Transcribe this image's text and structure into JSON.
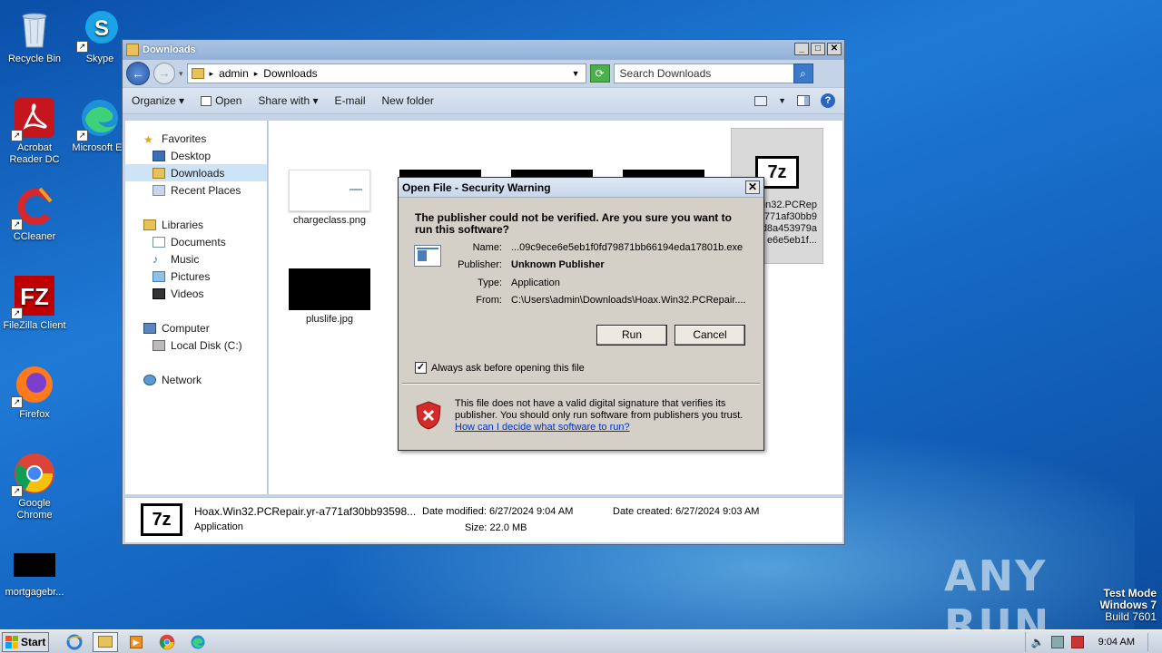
{
  "desktop": {
    "icons": [
      {
        "label": "Recycle Bin"
      },
      {
        "label": "Skype"
      },
      {
        "label": "Acrobat Reader DC"
      },
      {
        "label": "Microsoft Ed"
      },
      {
        "label": "CCleaner"
      },
      {
        "label": "FileZilla Client"
      },
      {
        "label": "Firefox"
      },
      {
        "label": "Google Chrome"
      },
      {
        "label": "mortgagebr..."
      }
    ],
    "watermark": "ANY RUN",
    "test_mode": {
      "line1": "Test Mode",
      "line2": "Windows 7",
      "line3": "Build 7601"
    }
  },
  "explorer": {
    "title": "Downloads",
    "breadcrumb": {
      "part1": "admin",
      "part2": "Downloads"
    },
    "search_placeholder": "Search Downloads",
    "toolbar": {
      "organize": "Organize",
      "open": "Open",
      "share_with": "Share with",
      "email": "E-mail",
      "new_folder": "New folder"
    },
    "nav": {
      "favorites": "Favorites",
      "desktop": "Desktop",
      "downloads": "Downloads",
      "recent": "Recent Places",
      "libraries": "Libraries",
      "documents": "Documents",
      "music": "Music",
      "pictures": "Pictures",
      "videos": "Videos",
      "computer": "Computer",
      "local_disk": "Local Disk (C:)",
      "network": "Network"
    },
    "files": {
      "chargeclass": "chargeclass.png",
      "pluslife": "pluslife.jpg",
      "hoax_line1": "Win32.PCRep",
      "hoax_line2": "a771af30bb9",
      "hoax_line3": "d8a453979a",
      "hoax_line4": "e6e5eb1f..."
    },
    "details": {
      "name": "Hoax.Win32.PCRepair.yr-a771af30bb93598...",
      "type": "Application",
      "modified_label": "Date modified:",
      "modified_value": "6/27/2024 9:04 AM",
      "size_label": "Size:",
      "size_value": "22.0 MB",
      "created_label": "Date created:",
      "created_value": "6/27/2024 9:03 AM"
    }
  },
  "dialog": {
    "title": "Open File - Security Warning",
    "question": "The publisher could not be verified.  Are you sure you want to run this software?",
    "name_label": "Name:",
    "name_value": "...09c9ece6e5eb1f0fd79871bb66194eda17801b.exe",
    "publisher_label": "Publisher:",
    "publisher_value": "Unknown Publisher",
    "type_label": "Type:",
    "type_value": "Application",
    "from_label": "From:",
    "from_value": "C:\\Users\\admin\\Downloads\\Hoax.Win32.PCRepair....",
    "run": "Run",
    "cancel": "Cancel",
    "checkbox_label": "Always ask before opening this file",
    "checkbox_checked": true,
    "warning": "This file does not have a valid digital signature that verifies its publisher.  You should only run software from publishers you trust.",
    "warning_link": "How can I decide what software to run?"
  },
  "taskbar": {
    "start": "Start",
    "clock": "9:04 AM"
  }
}
